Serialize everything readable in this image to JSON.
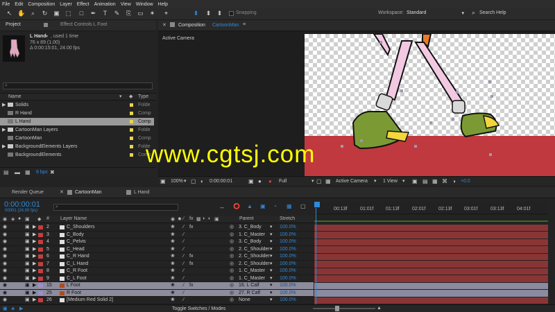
{
  "menu": [
    "File",
    "Edit",
    "Composition",
    "Layer",
    "Effect",
    "Animation",
    "View",
    "Window",
    "Help"
  ],
  "toolbar": {
    "snapping": "Snapping",
    "workspace_label": "Workspace:",
    "workspace_value": "Standard",
    "search_help": "Search Help"
  },
  "project": {
    "tab_project": "Project",
    "tab_effect_controls": "Effect Controls L Foot",
    "item_name": "L Hand",
    "used": ", used 1 time",
    "size": "76 x 89 (1.00)",
    "duration": "Δ 0:00:15:01, 24.00 fps",
    "col_name": "Name",
    "col_type": "Type",
    "bpc": "8 bpc",
    "items": [
      {
        "name": "Solids",
        "type": "Folde",
        "color": "#e8d44d",
        "folder": true
      },
      {
        "name": "R Hand",
        "type": "Comp",
        "color": "#e8d44d",
        "folder": false
      },
      {
        "name": "L Hand",
        "type": "Comp",
        "color": "#e8d44d",
        "folder": false,
        "selected": true
      },
      {
        "name": "CartoonMan Layers",
        "type": "Folde",
        "color": "#e8d44d",
        "folder": true
      },
      {
        "name": "CartoonMan",
        "type": "Comp",
        "color": "#e8d44d",
        "folder": false
      },
      {
        "name": "BackgroundElements Layers",
        "type": "Folde",
        "color": "#e8d44d",
        "folder": true
      },
      {
        "name": "BackgroundElements",
        "type": "Comp",
        "color": "#e8d44d",
        "folder": false
      }
    ]
  },
  "composition": {
    "tab_label": "Composition",
    "tab_name": "CartoonMan",
    "active_camera": "Active Camera",
    "zoom": "100%",
    "timecode": "0:00:00:01",
    "resolution": "Full",
    "camera": "Active Camera",
    "views": "1 View",
    "exposure": "+0.0"
  },
  "timeline": {
    "tab_render_queue": "Render Queue",
    "tab_cartoonman": "CartoonMan",
    "tab_lhand": "L Hand",
    "timecode": "0:00:00:01",
    "frames": "00001 (24.00 fps)",
    "col_num": "#",
    "col_layer_name": "Layer Name",
    "col_parent": "Parent",
    "col_stretch": "Stretch",
    "ruler": [
      "00:13f",
      "01:01f",
      "01:13f",
      "02:01f",
      "02:13f",
      "03:01f",
      "03:13f",
      "04:01f"
    ],
    "toggle": "Toggle Switches / Modes",
    "layers": [
      {
        "num": "2",
        "name": "C_Shoulders",
        "parent": "3. C_Body",
        "stretch": "100.0%",
        "color": "#c83c3c",
        "fx": true
      },
      {
        "num": "3",
        "name": "C_Body",
        "parent": "1. C_Master",
        "stretch": "100.0%",
        "color": "#c83c3c",
        "fx": false
      },
      {
        "num": "4",
        "name": "C_Pelvis",
        "parent": "3. C_Body",
        "stretch": "100.0%",
        "color": "#c83c3c",
        "fx": false
      },
      {
        "num": "5",
        "name": "C_Head",
        "parent": "2. C_Shoulder",
        "stretch": "100.0%",
        "color": "#c83c3c",
        "fx": false
      },
      {
        "num": "6",
        "name": "C_R Hand",
        "parent": "2. C_Shoulder",
        "stretch": "100.0%",
        "color": "#c83c3c",
        "fx": true
      },
      {
        "num": "7",
        "name": "C_L Hand",
        "parent": "2. C_Shoulder",
        "stretch": "100.0%",
        "color": "#c83c3c",
        "fx": true
      },
      {
        "num": "8",
        "name": "C_R Foot",
        "parent": "1. C_Master",
        "stretch": "100.0%",
        "color": "#c83c3c",
        "fx": false
      },
      {
        "num": "9",
        "name": "C_L Foot",
        "parent": "1. C_Master",
        "stretch": "100.0%",
        "color": "#c83c3c",
        "fx": false
      },
      {
        "num": "15",
        "name": "L Foot",
        "parent": "16. L Calf",
        "stretch": "100.0%",
        "color": "#9d8fc9",
        "fx": true,
        "selected": true
      },
      {
        "num": "25",
        "name": "R Foot",
        "parent": "27. R Calf",
        "stretch": "100.0%",
        "color": "#9d8fc9",
        "fx": false,
        "selected": true
      },
      {
        "num": "26",
        "name": "[Medium Red Solid 2]",
        "parent": "None",
        "stretch": "100.0%",
        "color": "#c83c3c",
        "fx": false
      }
    ]
  },
  "watermark": "www.cgtsj.com",
  "colors": {
    "accent": "#2f8ad8",
    "layer_bar": "#8a3535",
    "selected_bar": "#8a8aa0",
    "red_band": "#c0393e",
    "watermark": "#ffff00"
  }
}
